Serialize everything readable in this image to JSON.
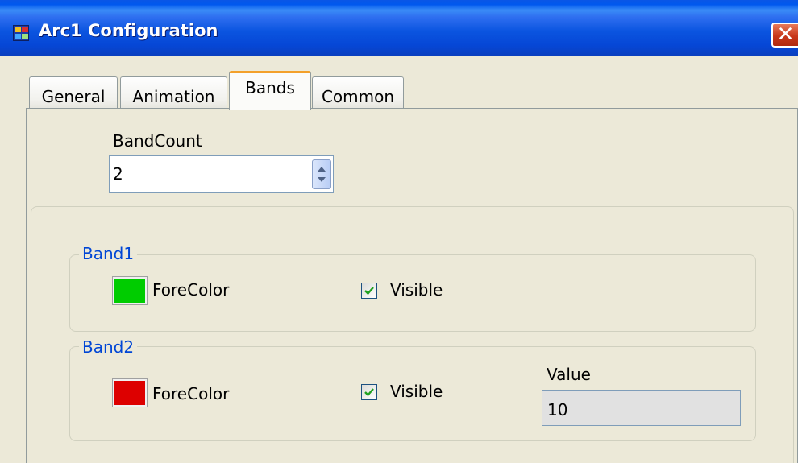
{
  "window": {
    "title": "Arc1 Configuration",
    "close_glyph": "✕"
  },
  "tabs": [
    {
      "label": "General"
    },
    {
      "label": "Animation"
    },
    {
      "label": "Bands",
      "active": true
    },
    {
      "label": "Common"
    }
  ],
  "bands_tab": {
    "band_count": {
      "label": "BandCount",
      "value": "2"
    },
    "bands": [
      {
        "title": "Band1",
        "forecolor_label": "ForeColor",
        "forecolor": "#00cc00",
        "visible_label": "Visible",
        "visible": true
      },
      {
        "title": "Band2",
        "forecolor_label": "ForeColor",
        "forecolor": "#dd0000",
        "visible_label": "Visible",
        "visible": true,
        "value_label": "Value",
        "value": "10"
      }
    ]
  },
  "icons": {
    "app": "app-window-icon",
    "close": "close-icon",
    "spin": "spin-updown-icon",
    "check": "checkmark-icon"
  },
  "colors": {
    "titlebar": "#0a56e6",
    "active_tab_accent": "#f3a02a",
    "group_title": "#0046d5",
    "face": "#ece9d8"
  }
}
